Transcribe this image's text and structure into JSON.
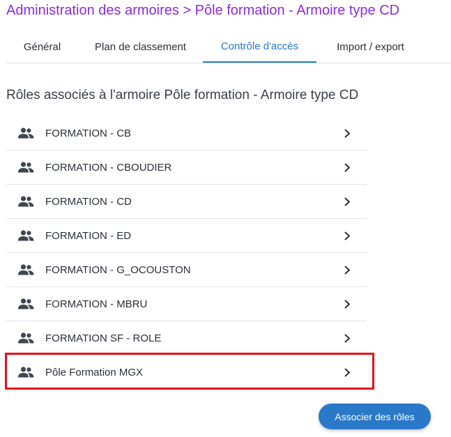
{
  "header": {
    "title": "Administration des armoires > Pôle formation - Armoire type CD"
  },
  "tabs": [
    {
      "label": "Général",
      "active": false
    },
    {
      "label": "Plan de classement",
      "active": false
    },
    {
      "label": "Contrôle d'accès",
      "active": true
    },
    {
      "label": "Import / export",
      "active": false
    }
  ],
  "section": {
    "title": "Rôles associés à l'armoire Pôle formation - Armoire type CD"
  },
  "roles": [
    {
      "label": "FORMATION - CB",
      "icon": "people-icon"
    },
    {
      "label": "FORMATION - CBOUDIER",
      "icon": "people-icon"
    },
    {
      "label": "FORMATION - CD",
      "icon": "people-icon"
    },
    {
      "label": "FORMATION - ED",
      "icon": "people-icon"
    },
    {
      "label": "FORMATION - G_OCOUSTON",
      "icon": "people-icon"
    },
    {
      "label": "FORMATION - MBRU",
      "icon": "people-icon"
    },
    {
      "label": "FORMATION SF - ROLE",
      "icon": "people-icon"
    },
    {
      "label": "Pôle Formation MGX",
      "icon": "people-icon",
      "highlighted": true
    }
  ],
  "actions": {
    "associate_label": "Associer des rôles"
  },
  "colors": {
    "title": "#8a2be2",
    "accent": "#2a78c8",
    "highlight": "#e8101a"
  }
}
